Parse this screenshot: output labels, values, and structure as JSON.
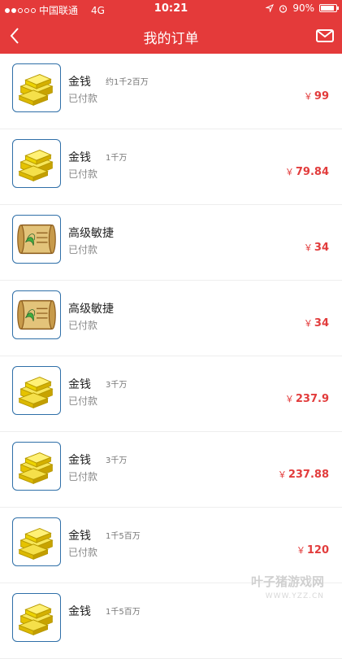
{
  "status_bar": {
    "carrier": "中国联通",
    "network": "4G",
    "time": "10:21",
    "battery": "90%",
    "battery_level": 0.9
  },
  "nav": {
    "title": "我的订单"
  },
  "colors": {
    "accent": "#e43a3a",
    "price": "#e23c3c",
    "thumb_border": "#2f6fa8"
  },
  "orders": [
    {
      "name": "金钱",
      "qty": "约1千2百万",
      "status": "已付款",
      "currency": "￥",
      "price": "99",
      "icon": "gold-bars-icon"
    },
    {
      "name": "金钱",
      "qty": "1千万",
      "status": "已付款",
      "currency": "￥",
      "price": "79.84",
      "icon": "gold-bars-icon"
    },
    {
      "name": "高级敏捷",
      "qty": "",
      "status": "已付款",
      "currency": "￥",
      "price": "34",
      "icon": "scroll-icon"
    },
    {
      "name": "高级敏捷",
      "qty": "",
      "status": "已付款",
      "currency": "￥",
      "price": "34",
      "icon": "scroll-icon"
    },
    {
      "name": "金钱",
      "qty": "3千万",
      "status": "已付款",
      "currency": "￥",
      "price": "237.9",
      "icon": "gold-bars-icon"
    },
    {
      "name": "金钱",
      "qty": "3千万",
      "status": "已付款",
      "currency": "￥",
      "price": "237.88",
      "icon": "gold-bars-icon"
    },
    {
      "name": "金钱",
      "qty": "1千5百万",
      "status": "已付款",
      "currency": "￥",
      "price": "120",
      "icon": "gold-bars-icon"
    },
    {
      "name": "金钱",
      "qty": "1千5百万",
      "status": "",
      "currency": "",
      "price": "",
      "icon": "gold-bars-icon"
    }
  ],
  "watermark": {
    "text": "叶子猪游戏网",
    "url": "WWW.YZZ.CN"
  }
}
